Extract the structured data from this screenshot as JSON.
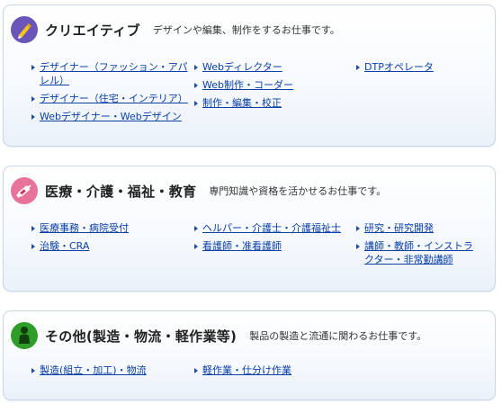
{
  "sections": [
    {
      "title": "クリエイティブ",
      "desc": "デザインや編集、制作をするお仕事です。",
      "icon": "pen-icon",
      "icon_color": "#6a55b8",
      "columns": [
        [
          "デザイナー（ファッション・アパレル）",
          "デザイナー（住宅・インテリア）",
          "Webデザイナー・Webデザイン"
        ],
        [
          "Webディレクター",
          "Web制作・コーダー",
          "制作・編集・校正"
        ],
        [
          "DTPオペレータ"
        ]
      ]
    },
    {
      "title": "医療・介護・福祉・教育",
      "desc": "専門知識や資格を活かせるお仕事です。",
      "icon": "syringe-icon",
      "icon_color": "#e8739a",
      "columns": [
        [
          "医療事務・病院受付",
          "治験・CRA"
        ],
        [
          "ヘルパー・介護士・介護福祉士",
          "看護師・准看護師"
        ],
        [
          "研究・研究開発",
          "講師・教師・インストラクター・非常勤講師"
        ]
      ]
    },
    {
      "title": "その他(製造・物流・軽作業等)",
      "desc": "製品の製造と流通に関わるお仕事です。",
      "icon": "person-icon",
      "icon_color": "#2f9d2a",
      "columns": [
        [
          "製造(組立・加工)・物流"
        ],
        [
          "軽作業・仕分け作業"
        ],
        []
      ]
    }
  ]
}
